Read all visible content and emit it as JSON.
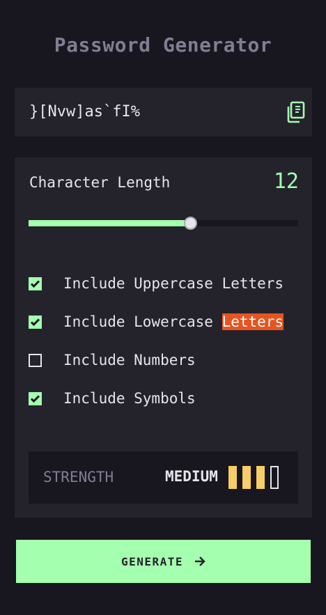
{
  "app": {
    "title": "Password Generator"
  },
  "output": {
    "password": "}[Nvw]as`fI%",
    "copy_icon": "copy-icon"
  },
  "length": {
    "label": "Character Length",
    "value": "12",
    "min": 0,
    "max": 20,
    "current": 12
  },
  "options": [
    {
      "label": "Include Uppercase Letters",
      "checked": true
    },
    {
      "label_prefix": "Include Lowercase ",
      "label_highlight": "Letters",
      "checked": true
    },
    {
      "label": "Include Numbers",
      "checked": false
    },
    {
      "label": "Include Symbols",
      "checked": true
    }
  ],
  "strength": {
    "label": "STRENGTH",
    "value": "MEDIUM",
    "level": 3,
    "total_bars": 4
  },
  "generate": {
    "label": "GENERATE",
    "icon": "arrow-right-icon"
  },
  "colors": {
    "background": "#18171f",
    "panel": "#24232c",
    "accent": "#a4ffaf",
    "strength_medium": "#f8cd65",
    "highlight": "#e8541f",
    "muted": "#817d92"
  }
}
